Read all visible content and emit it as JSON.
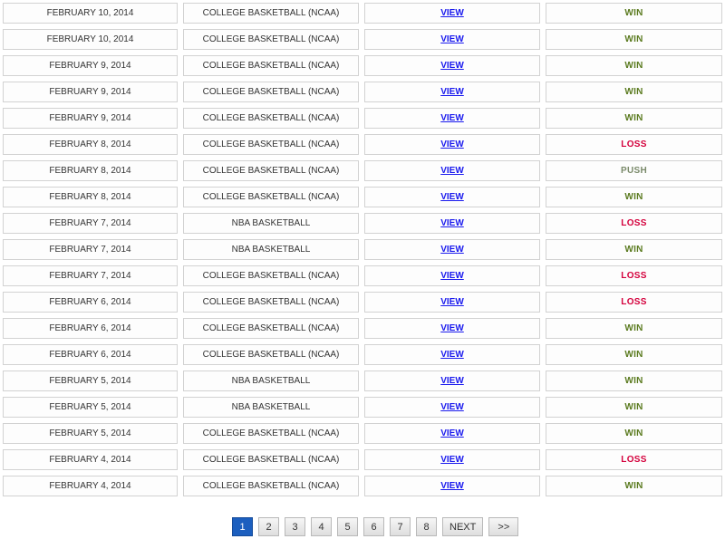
{
  "colors": {
    "win": "#5a7a1e",
    "loss": "#d4003c",
    "push": "#7a8a6a",
    "link": "#1a1aee",
    "active_page": "#1c5fbf"
  },
  "rows": [
    {
      "date": "FEBRUARY 10, 2014",
      "sport": "COLLEGE BASKETBALL (NCAA)",
      "view": "VIEW",
      "result": "WIN"
    },
    {
      "date": "FEBRUARY 10, 2014",
      "sport": "COLLEGE BASKETBALL (NCAA)",
      "view": "VIEW",
      "result": "WIN"
    },
    {
      "date": "FEBRUARY 9, 2014",
      "sport": "COLLEGE BASKETBALL (NCAA)",
      "view": "VIEW",
      "result": "WIN"
    },
    {
      "date": "FEBRUARY 9, 2014",
      "sport": "COLLEGE BASKETBALL (NCAA)",
      "view": "VIEW",
      "result": "WIN"
    },
    {
      "date": "FEBRUARY 9, 2014",
      "sport": "COLLEGE BASKETBALL (NCAA)",
      "view": "VIEW",
      "result": "WIN"
    },
    {
      "date": "FEBRUARY 8, 2014",
      "sport": "COLLEGE BASKETBALL (NCAA)",
      "view": "VIEW",
      "result": "LOSS"
    },
    {
      "date": "FEBRUARY 8, 2014",
      "sport": "COLLEGE BASKETBALL (NCAA)",
      "view": "VIEW",
      "result": "PUSH"
    },
    {
      "date": "FEBRUARY 8, 2014",
      "sport": "COLLEGE BASKETBALL (NCAA)",
      "view": "VIEW",
      "result": "WIN"
    },
    {
      "date": "FEBRUARY 7, 2014",
      "sport": "NBA BASKETBALL",
      "view": "VIEW",
      "result": "LOSS"
    },
    {
      "date": "FEBRUARY 7, 2014",
      "sport": "NBA BASKETBALL",
      "view": "VIEW",
      "result": "WIN"
    },
    {
      "date": "FEBRUARY 7, 2014",
      "sport": "COLLEGE BASKETBALL (NCAA)",
      "view": "VIEW",
      "result": "LOSS"
    },
    {
      "date": "FEBRUARY 6, 2014",
      "sport": "COLLEGE BASKETBALL (NCAA)",
      "view": "VIEW",
      "result": "LOSS"
    },
    {
      "date": "FEBRUARY 6, 2014",
      "sport": "COLLEGE BASKETBALL (NCAA)",
      "view": "VIEW",
      "result": "WIN"
    },
    {
      "date": "FEBRUARY 6, 2014",
      "sport": "COLLEGE BASKETBALL (NCAA)",
      "view": "VIEW",
      "result": "WIN"
    },
    {
      "date": "FEBRUARY 5, 2014",
      "sport": "NBA BASKETBALL",
      "view": "VIEW",
      "result": "WIN"
    },
    {
      "date": "FEBRUARY 5, 2014",
      "sport": "NBA BASKETBALL",
      "view": "VIEW",
      "result": "WIN"
    },
    {
      "date": "FEBRUARY 5, 2014",
      "sport": "COLLEGE BASKETBALL (NCAA)",
      "view": "VIEW",
      "result": "WIN"
    },
    {
      "date": "FEBRUARY 4, 2014",
      "sport": "COLLEGE BASKETBALL (NCAA)",
      "view": "VIEW",
      "result": "LOSS"
    },
    {
      "date": "FEBRUARY 4, 2014",
      "sport": "COLLEGE BASKETBALL (NCAA)",
      "view": "VIEW",
      "result": "WIN"
    }
  ],
  "pagination": {
    "pages": [
      "1",
      "2",
      "3",
      "4",
      "5",
      "6",
      "7",
      "8"
    ],
    "current": "1",
    "next_label": "NEXT",
    "last_label": ">>"
  }
}
